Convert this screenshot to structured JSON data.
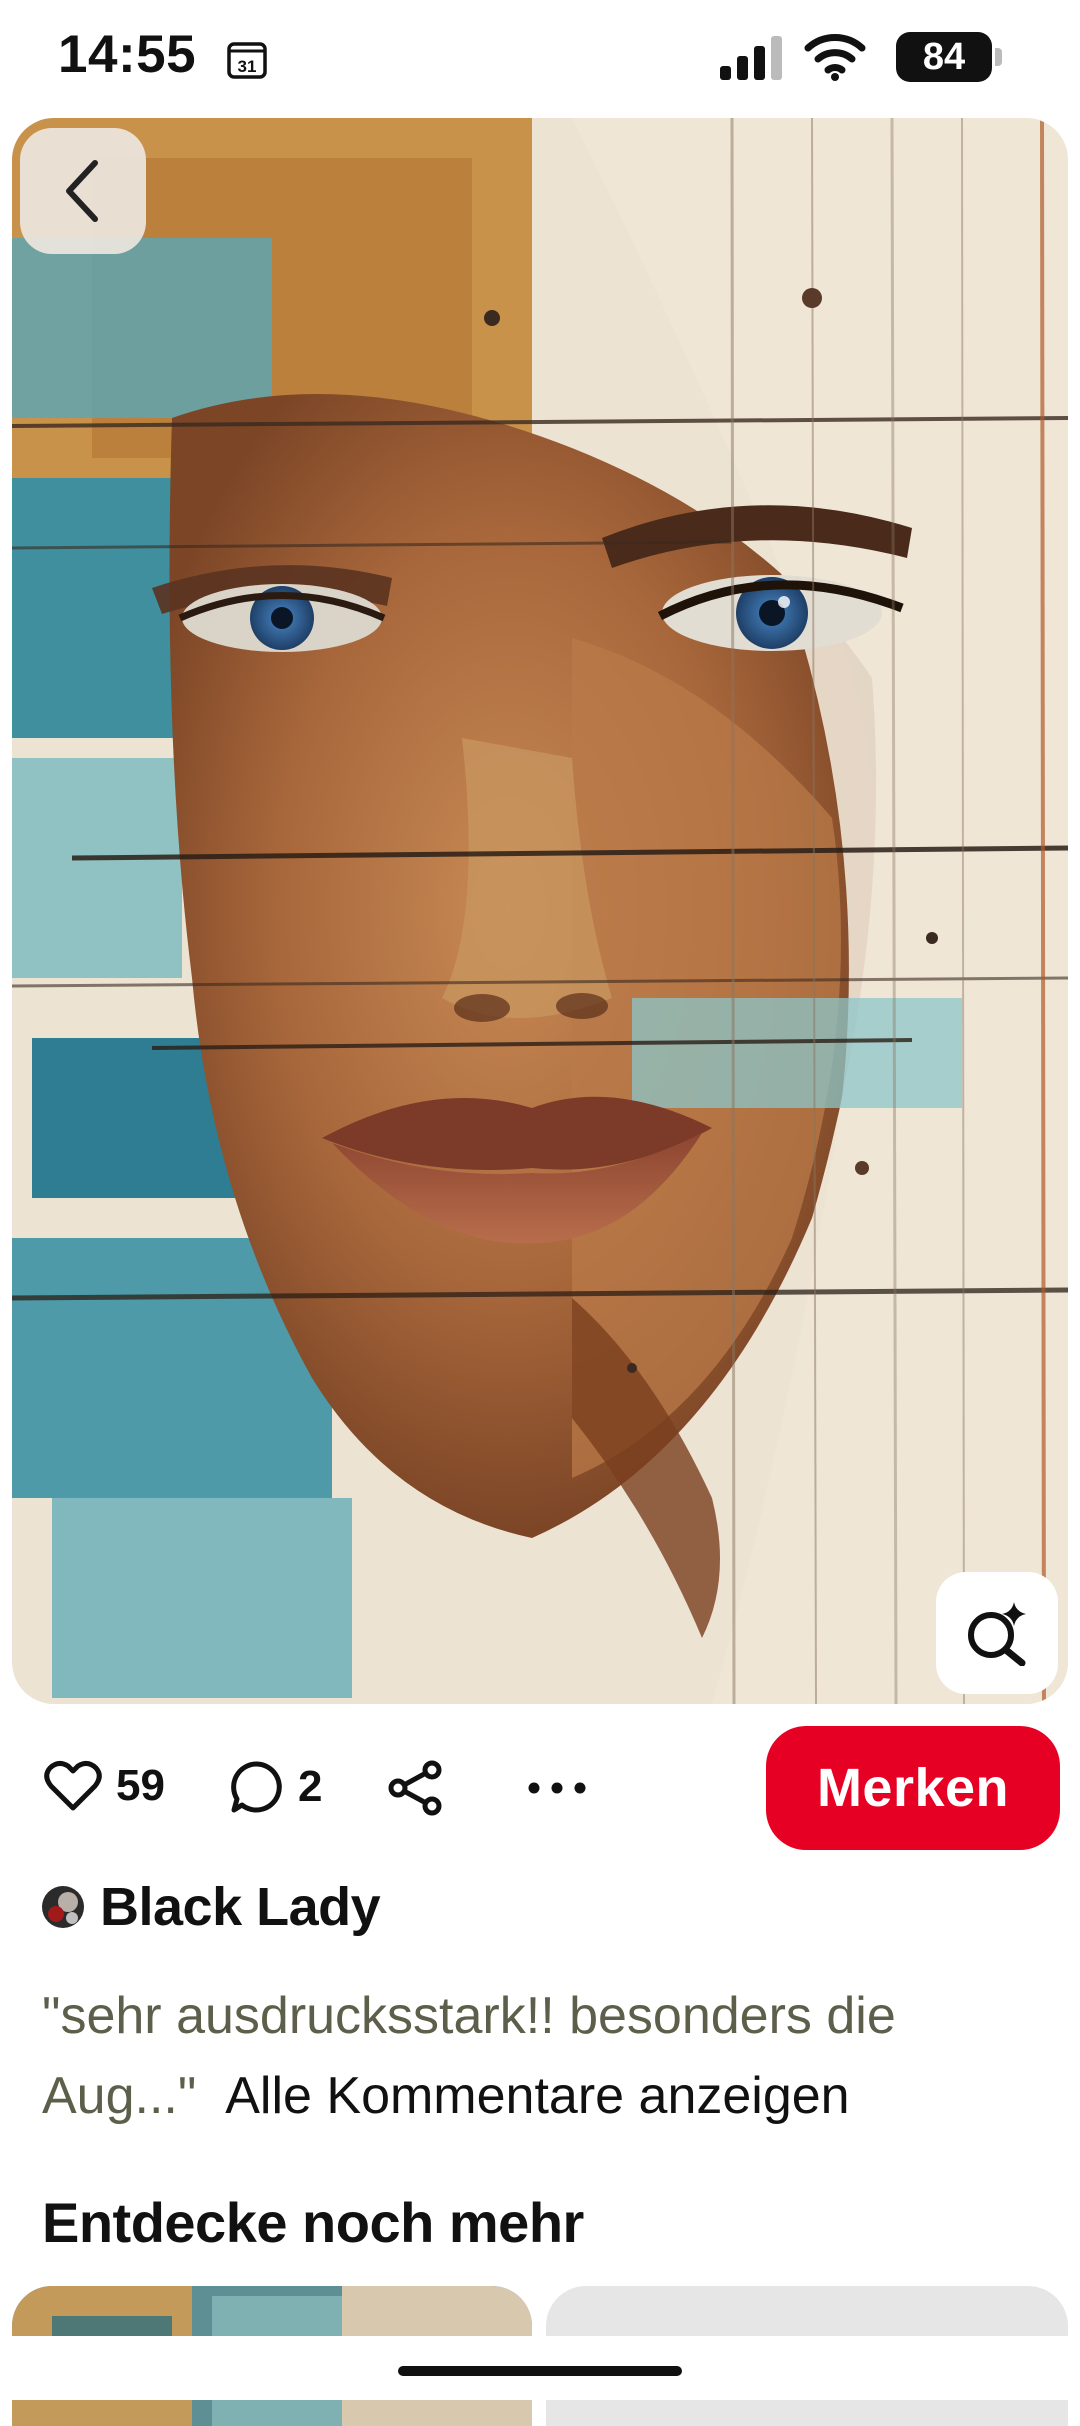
{
  "status_bar": {
    "time": "14:55",
    "calendar_day": "31",
    "battery_percent": "84",
    "icons": [
      "calendar-icon",
      "signal-icon",
      "wifi-icon",
      "battery-icon"
    ]
  },
  "pin": {
    "icons": {
      "back": "chevron-left-icon",
      "visual_search": "lens-sparkle-icon"
    }
  },
  "actions": {
    "like_count": "59",
    "comment_count": "2",
    "icons": [
      "heart-icon",
      "comment-icon",
      "share-icon",
      "more-icon"
    ],
    "save_label": "Merken",
    "save_color": "#e60023"
  },
  "author": {
    "name": "Black Lady"
  },
  "comment": {
    "quote": "\"sehr ausdrucksstark!! besonders die Aug...\"",
    "link": "Alle Kommentare anzeigen"
  },
  "more": {
    "title": "Entdecke noch mehr"
  }
}
